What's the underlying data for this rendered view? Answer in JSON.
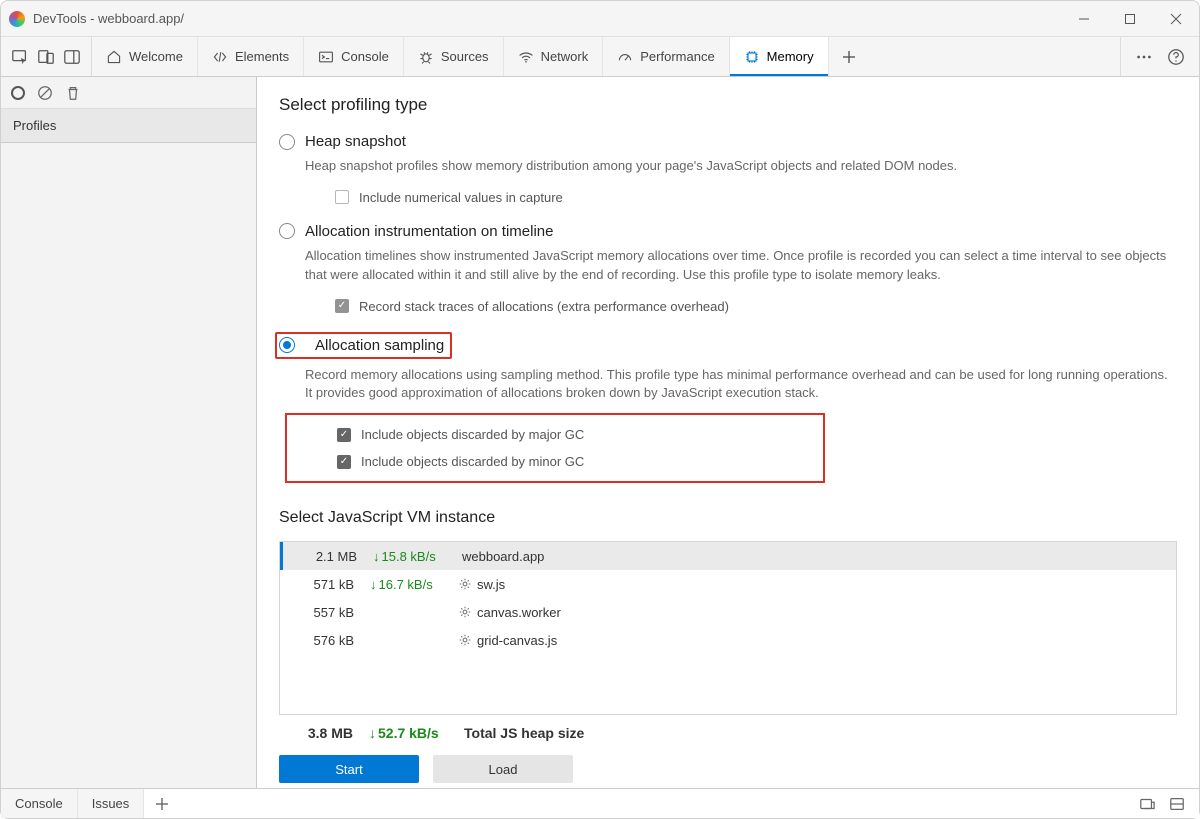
{
  "window": {
    "title": "DevTools - webboard.app/"
  },
  "tabs": {
    "welcome": "Welcome",
    "elements": "Elements",
    "console": "Console",
    "sources": "Sources",
    "network": "Network",
    "performance": "Performance",
    "memory": "Memory"
  },
  "sidebar": {
    "profiles_label": "Profiles"
  },
  "profiling": {
    "select_type_title": "Select profiling type",
    "heap": {
      "label": "Heap snapshot",
      "desc": "Heap snapshot profiles show memory distribution among your page's JavaScript objects and related DOM nodes.",
      "include_numerical": "Include numerical values in capture"
    },
    "timeline": {
      "label": "Allocation instrumentation on timeline",
      "desc": "Allocation timelines show instrumented JavaScript memory allocations over time. Once profile is recorded you can select a time interval to see objects that were allocated within it and still alive by the end of recording. Use this profile type to isolate memory leaks.",
      "record_stack": "Record stack traces of allocations (extra performance overhead)"
    },
    "sampling": {
      "label": "Allocation sampling",
      "desc": "Record memory allocations using sampling method. This profile type has minimal performance overhead and can be used for long running operations. It provides good approximation of allocations broken down by JavaScript execution stack.",
      "major_gc": "Include objects discarded by major GC",
      "minor_gc": "Include objects discarded by minor GC"
    }
  },
  "vm": {
    "title": "Select JavaScript VM instance",
    "rows": [
      {
        "size": "2.1 MB",
        "rate": "15.8 kB/s",
        "name": "webboard.app",
        "has_gear": false
      },
      {
        "size": "571 kB",
        "rate": "16.7 kB/s",
        "name": "sw.js",
        "has_gear": true
      },
      {
        "size": "557 kB",
        "rate": "",
        "name": "canvas.worker",
        "has_gear": true
      },
      {
        "size": "576 kB",
        "rate": "",
        "name": "grid-canvas.js",
        "has_gear": true
      }
    ],
    "total_size": "3.8 MB",
    "total_rate": "52.7 kB/s",
    "total_label": "Total JS heap size"
  },
  "buttons": {
    "start": "Start",
    "load": "Load"
  },
  "footer": {
    "console": "Console",
    "issues": "Issues"
  }
}
